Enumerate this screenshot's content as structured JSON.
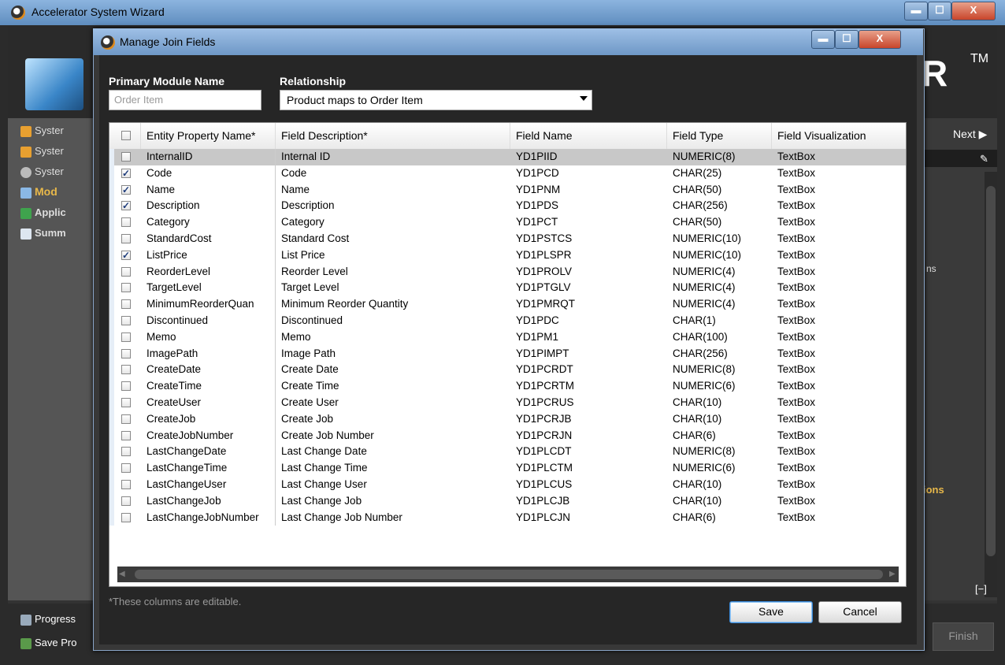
{
  "outer_window": {
    "title": "Accelerator System Wizard",
    "brand_text": "R",
    "brand_tm": "TM",
    "nav_items": [
      "Syster",
      "Syster",
      "Syster",
      "Mod",
      "Applic",
      "Summ"
    ],
    "next_label": "Next ▶",
    "right_text_1": "ns",
    "right_text_2": "ions",
    "collapse_label": "[−]",
    "bottom_items": [
      "Progress",
      "Save Pro"
    ],
    "finish_label": "Finish",
    "controls": {
      "minimize": "▬",
      "maximize": "☐",
      "close": "X"
    }
  },
  "dialog": {
    "title": "Manage Join Fields",
    "controls": {
      "minimize": "▬",
      "maximize": "☐",
      "close": "X"
    },
    "primary_module_label": "Primary Module Name",
    "primary_module_placeholder": "Order Item",
    "relationship_label": "Relationship",
    "relationship_value": "Product maps to Order Item",
    "columns": [
      "Entity Property Name*",
      "Field Description*",
      "Field Name",
      "Field Type",
      "Field Visualization"
    ],
    "rows": [
      {
        "checked": false,
        "selected": true,
        "entity": "InternalID",
        "desc": "Internal ID",
        "field": "YD1PIID",
        "type": "NUMERIC(8)",
        "vis": "TextBox"
      },
      {
        "checked": true,
        "entity": "Code",
        "desc": "Code",
        "field": "YD1PCD",
        "type": "CHAR(25)",
        "vis": "TextBox"
      },
      {
        "checked": true,
        "entity": "Name",
        "desc": "Name",
        "field": "YD1PNM",
        "type": "CHAR(50)",
        "vis": "TextBox"
      },
      {
        "checked": true,
        "entity": "Description",
        "desc": "Description",
        "field": "YD1PDS",
        "type": "CHAR(256)",
        "vis": "TextBox"
      },
      {
        "checked": false,
        "entity": "Category",
        "desc": "Category",
        "field": "YD1PCT",
        "type": "CHAR(50)",
        "vis": "TextBox"
      },
      {
        "checked": false,
        "entity": "StandardCost",
        "desc": "Standard Cost",
        "field": "YD1PSTCS",
        "type": "NUMERIC(10)",
        "vis": "TextBox"
      },
      {
        "checked": true,
        "entity": "ListPrice",
        "desc": "List Price",
        "field": "YD1PLSPR",
        "type": "NUMERIC(10)",
        "vis": "TextBox"
      },
      {
        "checked": false,
        "entity": "ReorderLevel",
        "desc": "Reorder Level",
        "field": "YD1PROLV",
        "type": "NUMERIC(4)",
        "vis": "TextBox"
      },
      {
        "checked": false,
        "entity": "TargetLevel",
        "desc": "Target Level",
        "field": "YD1PTGLV",
        "type": "NUMERIC(4)",
        "vis": "TextBox"
      },
      {
        "checked": false,
        "entity": "MinimumReorderQuan",
        "desc": "Minimum Reorder Quantity",
        "field": "YD1PMRQT",
        "type": "NUMERIC(4)",
        "vis": "TextBox"
      },
      {
        "checked": false,
        "entity": "Discontinued",
        "desc": "Discontinued",
        "field": "YD1PDC",
        "type": "CHAR(1)",
        "vis": "TextBox"
      },
      {
        "checked": false,
        "entity": "Memo",
        "desc": "Memo",
        "field": "YD1PM1",
        "type": "CHAR(100)",
        "vis": "TextBox"
      },
      {
        "checked": false,
        "entity": "ImagePath",
        "desc": "Image Path",
        "field": "YD1PIMPT",
        "type": "CHAR(256)",
        "vis": "TextBox"
      },
      {
        "checked": false,
        "entity": "CreateDate",
        "desc": "Create Date",
        "field": "YD1PCRDT",
        "type": "NUMERIC(8)",
        "vis": "TextBox"
      },
      {
        "checked": false,
        "entity": "CreateTime",
        "desc": "Create Time",
        "field": "YD1PCRTM",
        "type": "NUMERIC(6)",
        "vis": "TextBox"
      },
      {
        "checked": false,
        "entity": "CreateUser",
        "desc": "Create User",
        "field": "YD1PCRUS",
        "type": "CHAR(10)",
        "vis": "TextBox"
      },
      {
        "checked": false,
        "entity": "CreateJob",
        "desc": "Create Job",
        "field": "YD1PCRJB",
        "type": "CHAR(10)",
        "vis": "TextBox"
      },
      {
        "checked": false,
        "entity": "CreateJobNumber",
        "desc": "Create Job Number",
        "field": "YD1PCRJN",
        "type": "CHAR(6)",
        "vis": "TextBox"
      },
      {
        "checked": false,
        "entity": "LastChangeDate",
        "desc": "Last Change Date",
        "field": "YD1PLCDT",
        "type": "NUMERIC(8)",
        "vis": "TextBox"
      },
      {
        "checked": false,
        "entity": "LastChangeTime",
        "desc": "Last Change Time",
        "field": "YD1PLCTM",
        "type": "NUMERIC(6)",
        "vis": "TextBox"
      },
      {
        "checked": false,
        "entity": "LastChangeUser",
        "desc": "Last Change User",
        "field": "YD1PLCUS",
        "type": "CHAR(10)",
        "vis": "TextBox"
      },
      {
        "checked": false,
        "entity": "LastChangeJob",
        "desc": "Last Change Job",
        "field": "YD1PLCJB",
        "type": "CHAR(10)",
        "vis": "TextBox"
      },
      {
        "checked": false,
        "entity": "LastChangeJobNumber",
        "desc": "Last Change Job Number",
        "field": "YD1PLCJN",
        "type": "CHAR(6)",
        "vis": "TextBox"
      }
    ],
    "footnote": "*These columns are editable.",
    "save_label": "Save",
    "cancel_label": "Cancel"
  },
  "colors": {
    "title_bar": "#6e97c6",
    "dialog_bg": "#262626",
    "accent_orange": "#e8b84a"
  }
}
